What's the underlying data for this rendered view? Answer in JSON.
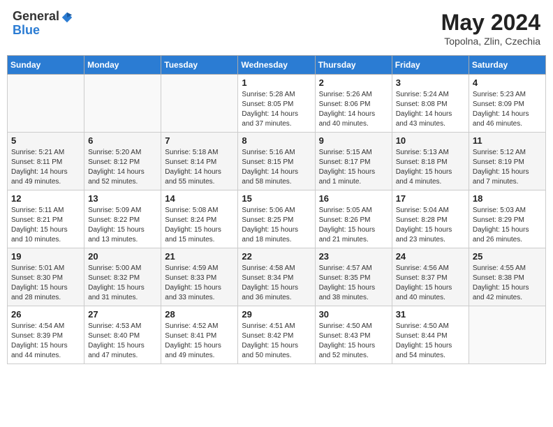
{
  "header": {
    "logo_general": "General",
    "logo_blue": "Blue",
    "month_year": "May 2024",
    "location": "Topolna, Zlin, Czechia"
  },
  "columns": [
    "Sunday",
    "Monday",
    "Tuesday",
    "Wednesday",
    "Thursday",
    "Friday",
    "Saturday"
  ],
  "weeks": [
    [
      {
        "day": "",
        "info": ""
      },
      {
        "day": "",
        "info": ""
      },
      {
        "day": "",
        "info": ""
      },
      {
        "day": "1",
        "info": "Sunrise: 5:28 AM\nSunset: 8:05 PM\nDaylight: 14 hours\nand 37 minutes."
      },
      {
        "day": "2",
        "info": "Sunrise: 5:26 AM\nSunset: 8:06 PM\nDaylight: 14 hours\nand 40 minutes."
      },
      {
        "day": "3",
        "info": "Sunrise: 5:24 AM\nSunset: 8:08 PM\nDaylight: 14 hours\nand 43 minutes."
      },
      {
        "day": "4",
        "info": "Sunrise: 5:23 AM\nSunset: 8:09 PM\nDaylight: 14 hours\nand 46 minutes."
      }
    ],
    [
      {
        "day": "5",
        "info": "Sunrise: 5:21 AM\nSunset: 8:11 PM\nDaylight: 14 hours\nand 49 minutes."
      },
      {
        "day": "6",
        "info": "Sunrise: 5:20 AM\nSunset: 8:12 PM\nDaylight: 14 hours\nand 52 minutes."
      },
      {
        "day": "7",
        "info": "Sunrise: 5:18 AM\nSunset: 8:14 PM\nDaylight: 14 hours\nand 55 minutes."
      },
      {
        "day": "8",
        "info": "Sunrise: 5:16 AM\nSunset: 8:15 PM\nDaylight: 14 hours\nand 58 minutes."
      },
      {
        "day": "9",
        "info": "Sunrise: 5:15 AM\nSunset: 8:17 PM\nDaylight: 15 hours\nand 1 minute."
      },
      {
        "day": "10",
        "info": "Sunrise: 5:13 AM\nSunset: 8:18 PM\nDaylight: 15 hours\nand 4 minutes."
      },
      {
        "day": "11",
        "info": "Sunrise: 5:12 AM\nSunset: 8:19 PM\nDaylight: 15 hours\nand 7 minutes."
      }
    ],
    [
      {
        "day": "12",
        "info": "Sunrise: 5:11 AM\nSunset: 8:21 PM\nDaylight: 15 hours\nand 10 minutes."
      },
      {
        "day": "13",
        "info": "Sunrise: 5:09 AM\nSunset: 8:22 PM\nDaylight: 15 hours\nand 13 minutes."
      },
      {
        "day": "14",
        "info": "Sunrise: 5:08 AM\nSunset: 8:24 PM\nDaylight: 15 hours\nand 15 minutes."
      },
      {
        "day": "15",
        "info": "Sunrise: 5:06 AM\nSunset: 8:25 PM\nDaylight: 15 hours\nand 18 minutes."
      },
      {
        "day": "16",
        "info": "Sunrise: 5:05 AM\nSunset: 8:26 PM\nDaylight: 15 hours\nand 21 minutes."
      },
      {
        "day": "17",
        "info": "Sunrise: 5:04 AM\nSunset: 8:28 PM\nDaylight: 15 hours\nand 23 minutes."
      },
      {
        "day": "18",
        "info": "Sunrise: 5:03 AM\nSunset: 8:29 PM\nDaylight: 15 hours\nand 26 minutes."
      }
    ],
    [
      {
        "day": "19",
        "info": "Sunrise: 5:01 AM\nSunset: 8:30 PM\nDaylight: 15 hours\nand 28 minutes."
      },
      {
        "day": "20",
        "info": "Sunrise: 5:00 AM\nSunset: 8:32 PM\nDaylight: 15 hours\nand 31 minutes."
      },
      {
        "day": "21",
        "info": "Sunrise: 4:59 AM\nSunset: 8:33 PM\nDaylight: 15 hours\nand 33 minutes."
      },
      {
        "day": "22",
        "info": "Sunrise: 4:58 AM\nSunset: 8:34 PM\nDaylight: 15 hours\nand 36 minutes."
      },
      {
        "day": "23",
        "info": "Sunrise: 4:57 AM\nSunset: 8:35 PM\nDaylight: 15 hours\nand 38 minutes."
      },
      {
        "day": "24",
        "info": "Sunrise: 4:56 AM\nSunset: 8:37 PM\nDaylight: 15 hours\nand 40 minutes."
      },
      {
        "day": "25",
        "info": "Sunrise: 4:55 AM\nSunset: 8:38 PM\nDaylight: 15 hours\nand 42 minutes."
      }
    ],
    [
      {
        "day": "26",
        "info": "Sunrise: 4:54 AM\nSunset: 8:39 PM\nDaylight: 15 hours\nand 44 minutes."
      },
      {
        "day": "27",
        "info": "Sunrise: 4:53 AM\nSunset: 8:40 PM\nDaylight: 15 hours\nand 47 minutes."
      },
      {
        "day": "28",
        "info": "Sunrise: 4:52 AM\nSunset: 8:41 PM\nDaylight: 15 hours\nand 49 minutes."
      },
      {
        "day": "29",
        "info": "Sunrise: 4:51 AM\nSunset: 8:42 PM\nDaylight: 15 hours\nand 50 minutes."
      },
      {
        "day": "30",
        "info": "Sunrise: 4:50 AM\nSunset: 8:43 PM\nDaylight: 15 hours\nand 52 minutes."
      },
      {
        "day": "31",
        "info": "Sunrise: 4:50 AM\nSunset: 8:44 PM\nDaylight: 15 hours\nand 54 minutes."
      },
      {
        "day": "",
        "info": ""
      }
    ]
  ]
}
